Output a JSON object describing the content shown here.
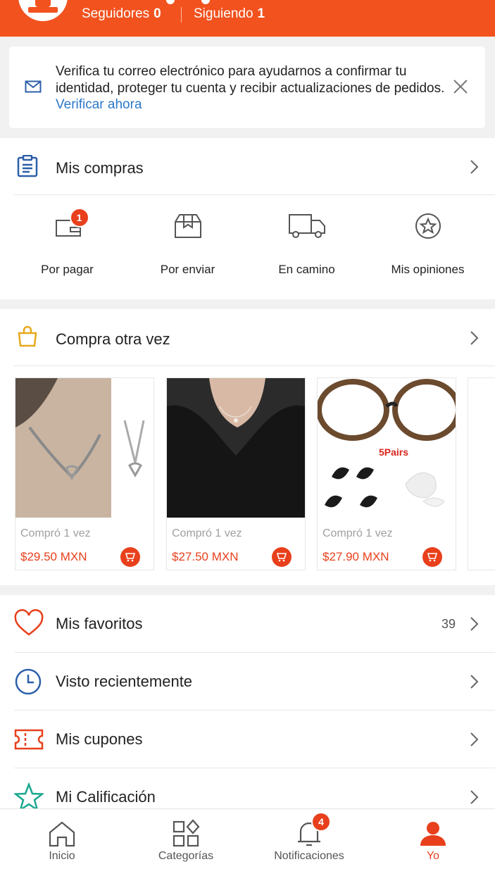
{
  "header": {
    "followers_label": "Seguidores",
    "followers_count": "0",
    "following_label": "Siguiendo",
    "following_count": "1"
  },
  "verify_banner": {
    "text": "Verifica tu correo electrónico para ayudarnos a confirmar tu identidad, proteger tu cuenta y recibir actualizaciones de pedidos.",
    "link": "Verificar ahora"
  },
  "purchases": {
    "title": "Mis compras",
    "statuses": [
      {
        "label": "Por pagar",
        "icon": "wallet-icon",
        "badge": "1"
      },
      {
        "label": "Por enviar",
        "icon": "box-icon"
      },
      {
        "label": "En camino",
        "icon": "truck-icon"
      },
      {
        "label": "Mis opiniones",
        "icon": "star-circle-icon"
      }
    ]
  },
  "buy_again": {
    "title": "Compra otra vez",
    "products": [
      {
        "bought": "Compró 1 vez",
        "price": "$29.50 MXN"
      },
      {
        "bought": "Compró 1 vez",
        "price": "$27.50 MXN"
      },
      {
        "bought": "Compró 1 vez",
        "price": "$27.90 MXN",
        "overlay_text": "5Pairs"
      }
    ]
  },
  "menu": [
    {
      "label": "Mis favoritos",
      "icon": "heart-icon",
      "count": "39"
    },
    {
      "label": "Visto recientemente",
      "icon": "clock-icon"
    },
    {
      "label": "Mis cupones",
      "icon": "coupon-icon"
    },
    {
      "label": "Mi Calificación",
      "icon": "star-icon"
    }
  ],
  "tabbar": [
    {
      "label": "Inicio",
      "icon": "home-icon"
    },
    {
      "label": "Categorías",
      "icon": "categories-icon"
    },
    {
      "label": "Notificaciones",
      "icon": "bell-icon",
      "badge": "4"
    },
    {
      "label": "Yo",
      "icon": "person-icon",
      "active": true
    }
  ],
  "colors": {
    "accent": "#f2521e",
    "price": "#e8401c",
    "link": "#2c78c7"
  }
}
